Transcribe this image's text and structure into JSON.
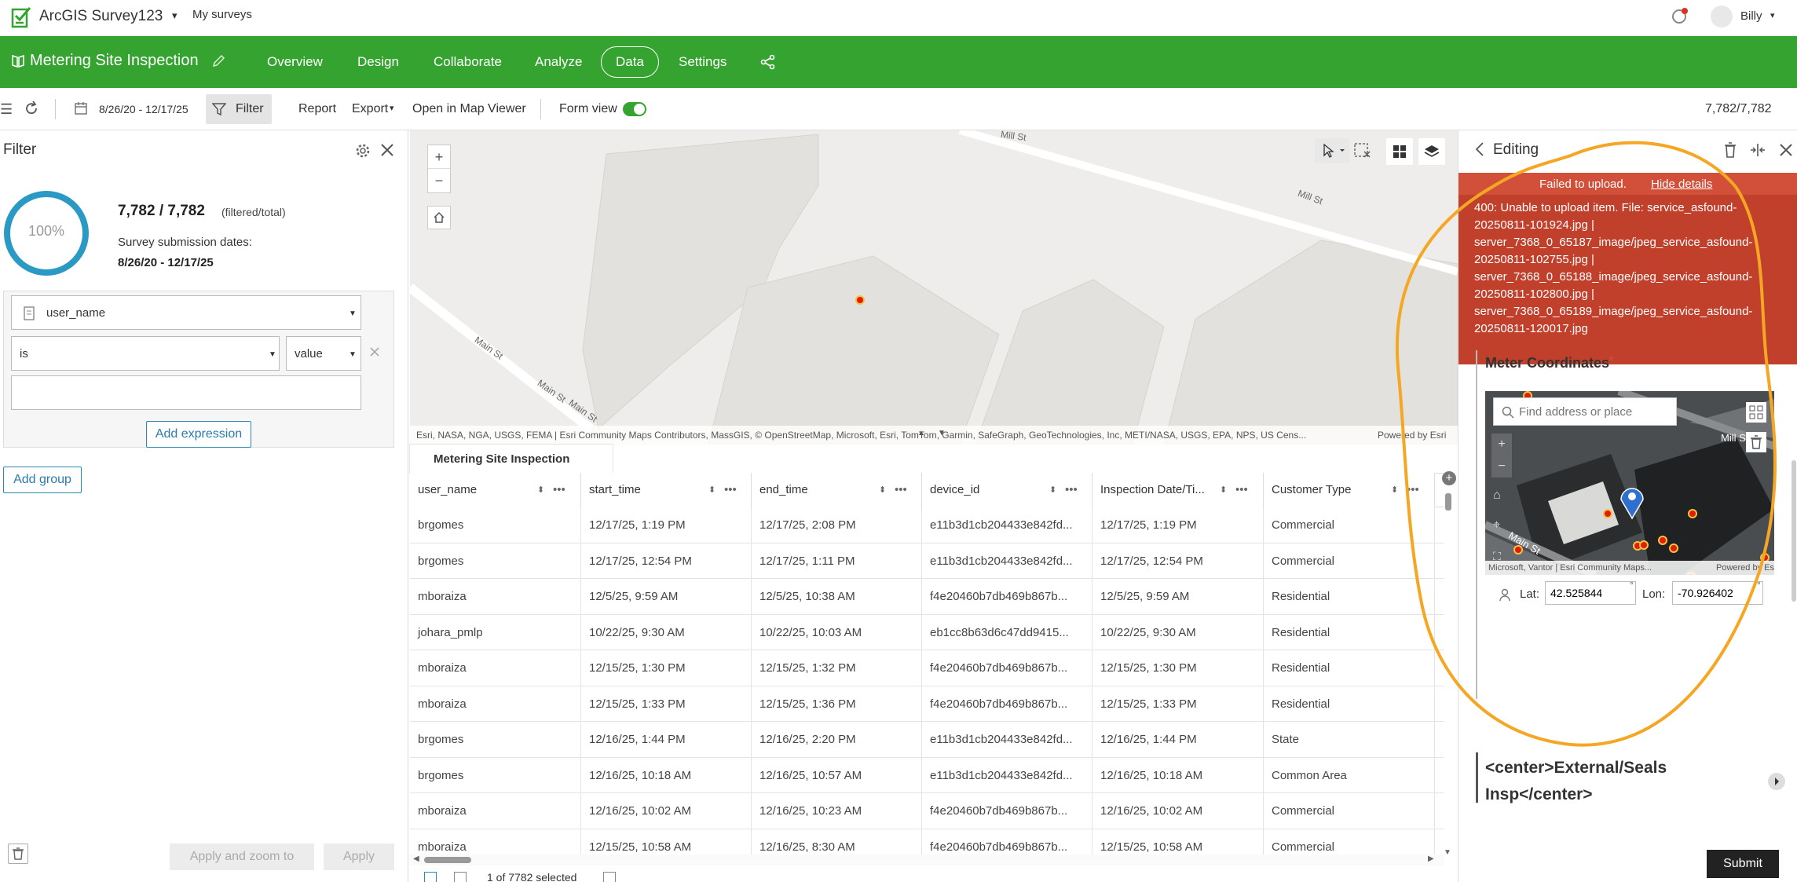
{
  "app": {
    "name": "ArcGIS Survey123",
    "my_surveys": "My surveys",
    "user": "Billy"
  },
  "survey": {
    "title": "Metering Site Inspection",
    "tabs": [
      "Overview",
      "Design",
      "Collaborate",
      "Analyze",
      "Data",
      "Settings"
    ],
    "active_tab": "Data"
  },
  "toolbar": {
    "date_range": "8/26/20 - 12/17/25",
    "filter": "Filter",
    "report": "Report",
    "export": "Export",
    "open_map_viewer": "Open in Map Viewer",
    "form_view": "Form view",
    "count": "7,782/7,782"
  },
  "filter": {
    "title": "Filter",
    "percent": "100%",
    "percent_value": 100,
    "counts": "7,782 / 7,782",
    "counts_suffix": "(filtered/total)",
    "dates_label": "Survey submission dates:",
    "dates_value": "8/26/20 - 12/17/25",
    "field": "user_name",
    "operator": "is",
    "value_type": "value",
    "value_input": "",
    "add_expression": "Add expression",
    "add_group": "Add group",
    "apply_zoom": "Apply and zoom to",
    "apply": "Apply"
  },
  "map": {
    "streets": [
      "Mill St",
      "Mill St",
      "Main St",
      "Main St",
      "Main St"
    ],
    "attribution": "Esri, NASA, NGA, USGS, FEMA | Esri Community Maps Contributors, MassGIS, © OpenStreetMap, Microsoft, Esri, TomTom, Garmin, SafeGraph, GeoTechnologies, Inc, METI/NASA, USGS, EPA, NPS, US Cens...",
    "powered_by": "Powered by Esri"
  },
  "table": {
    "tab_title": "Metering Site Inspection",
    "columns": [
      "user_name",
      "start_time",
      "end_time",
      "device_id",
      "Inspection Date/Ti...",
      "Customer Type"
    ],
    "rows": [
      [
        "brgomes",
        "12/17/25, 1:19 PM",
        "12/17/25, 2:08 PM",
        "e11b3d1cb204433e842fd...",
        "12/17/25, 1:19 PM",
        "Commercial"
      ],
      [
        "brgomes",
        "12/17/25, 12:54 PM",
        "12/17/25, 1:11 PM",
        "e11b3d1cb204433e842fd...",
        "12/17/25, 12:54 PM",
        "Commercial"
      ],
      [
        "mboraiza",
        "12/5/25, 9:59 AM",
        "12/5/25, 10:38 AM",
        "f4e20460b7db469b867b...",
        "12/5/25, 9:59 AM",
        "Residential"
      ],
      [
        "johara_pmlp",
        "10/22/25, 9:30 AM",
        "10/22/25, 10:03 AM",
        "eb1cc8b63d6c47dd9415...",
        "10/22/25, 9:30 AM",
        "Residential"
      ],
      [
        "mboraiza",
        "12/15/25, 1:30 PM",
        "12/15/25, 1:32 PM",
        "f4e20460b7db469b867b...",
        "12/15/25, 1:30 PM",
        "Residential"
      ],
      [
        "mboraiza",
        "12/15/25, 1:33 PM",
        "12/15/25, 1:36 PM",
        "f4e20460b7db469b867b...",
        "12/15/25, 1:33 PM",
        "Residential"
      ],
      [
        "brgomes",
        "12/16/25, 1:44 PM",
        "12/16/25, 2:20 PM",
        "e11b3d1cb204433e842fd...",
        "12/16/25, 1:44 PM",
        "State"
      ],
      [
        "brgomes",
        "12/16/25, 10:18 AM",
        "12/16/25, 10:57 AM",
        "e11b3d1cb204433e842fd...",
        "12/16/25, 10:18 AM",
        "Common Area"
      ],
      [
        "mboraiza",
        "12/16/25, 10:02 AM",
        "12/16/25, 10:23 AM",
        "f4e20460b7db469b867b...",
        "12/16/25, 10:02 AM",
        "Commercial"
      ],
      [
        "mboraiza",
        "12/15/25, 10:58 AM",
        "12/16/25, 8:30 AM",
        "f4e20460b7db469b867b...",
        "12/15/25, 10:58 AM",
        "Commercial"
      ]
    ],
    "selection": "1 of 7782 selected"
  },
  "editing": {
    "title": "Editing",
    "error_title": "Failed to upload.",
    "hide_details": "Hide details",
    "error_lines": [
      "400: Unable to upload item. File: service_asfound-",
      "20250811-101924.jpg |",
      "server_7368_0_65187_image/jpeg_service_asfound-",
      "20250811-102755.jpg |",
      "server_7368_0_65188_image/jpeg_service_asfound-",
      "20250811-102800.jpg |",
      "server_7368_0_65189_image/jpeg_service_asfound-",
      "20250811-120017.jpg"
    ],
    "meter_label": "Meter Coordinates",
    "required_mark": "*",
    "find_placeholder": "Find address or place",
    "mini_streets": [
      "Mill St",
      "Main St"
    ],
    "mini_attribution": "Microsoft, Vantor | Esri Community Maps...",
    "mini_powered": "Powered by Esri",
    "lat_label": "Lat:",
    "lat_value": "42.525844",
    "lon_label": "Lon:",
    "lon_value": "-70.926402",
    "degree": "°",
    "section_title_1": "<center>External/Seals",
    "section_title_2": "Insp</center>",
    "submit": "Submit"
  },
  "colors": {
    "brand_green": "#35a32f",
    "error_red": "#d2503a",
    "accent_blue": "#2a8ab8",
    "annotation_orange": "#f5a623",
    "map_point": "#e21b0c"
  }
}
